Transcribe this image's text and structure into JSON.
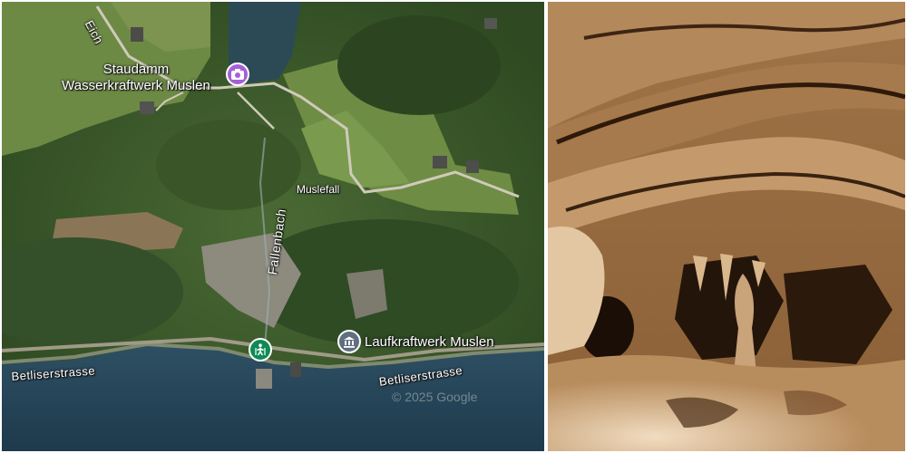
{
  "map": {
    "labels": {
      "eich": "Eich",
      "staudamm_line1": "Staudamm",
      "staudamm_line2": "Wasserkraftwerk Muslen",
      "fallenbach": "Fallenbach",
      "muslefall": "Muslefall",
      "laufkraftwerk": "Laufkraftwerk Muslen",
      "betliserstrasse_west": "Betliserstrasse",
      "betliserstrasse_east": "Betliserstrasse"
    },
    "copyright": "© 2025 Google",
    "pins": {
      "camera": {
        "icon": "camera-icon",
        "color": "#a560d8"
      },
      "hiking": {
        "icon": "hiking-icon",
        "color": "#0f8a55"
      },
      "building": {
        "icon": "museum-icon",
        "color": "#5f6e80"
      }
    }
  },
  "photo": {
    "subject": "cave-interior"
  }
}
